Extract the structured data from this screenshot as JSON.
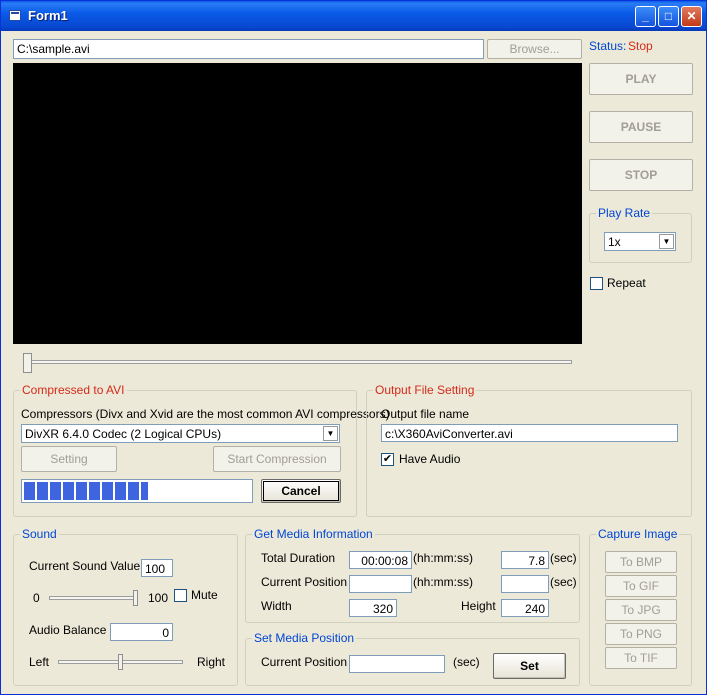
{
  "window": {
    "title": "Form1",
    "controls": {
      "minimize": "_",
      "maximize": "□",
      "close": "✕"
    }
  },
  "file": {
    "path": "C:\\sample.avi",
    "browse_label": "Browse..."
  },
  "status": {
    "label": "Status:",
    "value": "Stop"
  },
  "playback": {
    "play_label": "PLAY",
    "pause_label": "PAUSE",
    "stop_label": "STOP"
  },
  "play_rate": {
    "title": "Play Rate",
    "value": "1x"
  },
  "repeat": {
    "label": "Repeat",
    "checked": false
  },
  "seek": {
    "position": 0
  },
  "compress": {
    "title": "Compressed to AVI",
    "compressors_label": "Compressors (Divx and Xvid are the most common AVI compressors)",
    "selected": "DivXR 6.4.0 Codec (2 Logical CPUs)",
    "setting_label": "Setting",
    "start_label": "Start Compression",
    "progress": 0.55,
    "cancel_label": "Cancel"
  },
  "output": {
    "title": "Output File Setting",
    "name_label": "Output file name",
    "name_value": "c:\\X360AviConverter.avi",
    "have_audio_label": "Have Audio",
    "have_audio_checked": true
  },
  "sound": {
    "title": "Sound",
    "current_label": "Current Sound Value:",
    "current_value": "100",
    "min": "0",
    "max": "100",
    "mute_label": "Mute",
    "balance_label": "Audio Balance",
    "balance_value": "0",
    "left_label": "Left",
    "right_label": "Right",
    "volume_level": 1.0,
    "balance_level": 0.5
  },
  "media_info": {
    "title": "Get Media Information",
    "total_duration_label": "Total Duration",
    "total_duration_value": "00:00:08",
    "hms1": "(hh:mm:ss)",
    "sec_value": "7.8",
    "sec1": "(sec)",
    "current_position_label": "Current Position",
    "current_position_value": "",
    "hms2": "(hh:mm:ss)",
    "sec2_value": "",
    "sec2": "(sec)",
    "width_label": "Width",
    "width_value": "320",
    "height_label": "Height",
    "height_value": "240"
  },
  "set_position": {
    "title": "Set Media Position",
    "current_position_label": "Current Position",
    "value": "",
    "sec_label": "(sec)",
    "set_label": "Set"
  },
  "capture": {
    "title": "Capture Image",
    "bmp": "To BMP",
    "gif": "To GIF",
    "jpg": "To JPG",
    "png": "To PNG",
    "tif": "To TIF"
  },
  "colors": {
    "title_bar": "#0a5be8",
    "status_red": "#d52a1a",
    "group_blue": "#0046d5",
    "progress": "#3e64df"
  }
}
